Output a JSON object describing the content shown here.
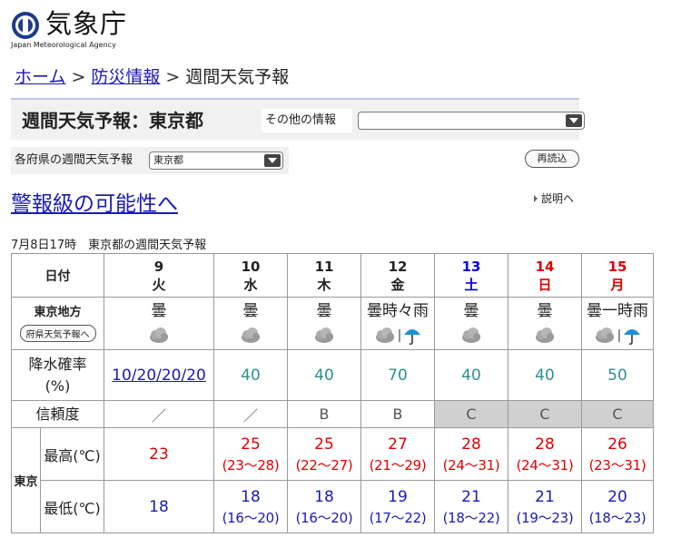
{
  "header": {
    "logo_text": "気象庁",
    "logo_sub": "Japan Meteorological Agency"
  },
  "breadcrumb": {
    "home": "ホーム",
    "sep": ">",
    "disaster": "防災情報",
    "current": "週間天気予報"
  },
  "title_box": {
    "title": "週間天気予報：東京都",
    "other_info_label": "その他の情報",
    "other_info_value": ""
  },
  "pref_bar": {
    "label": "各府県の週間天気予報",
    "selected": "東京都",
    "reload": "再読込"
  },
  "warning_link": "警報級の可能性へ",
  "explain_link": "説明へ",
  "caption": "7月8日17時　東京都の週間天気予報",
  "table": {
    "date_header": "日付",
    "days": [
      {
        "num": "9",
        "wk": "火",
        "color": "#222222"
      },
      {
        "num": "10",
        "wk": "水",
        "color": "#222222"
      },
      {
        "num": "11",
        "wk": "木",
        "color": "#222222"
      },
      {
        "num": "12",
        "wk": "金",
        "color": "#222222"
      },
      {
        "num": "13",
        "wk": "土",
        "color": "#0000e0"
      },
      {
        "num": "14",
        "wk": "日",
        "color": "#e00000"
      },
      {
        "num": "15",
        "wk": "月",
        "color": "#e00000"
      }
    ],
    "region": "東京地方",
    "pref_button": "府県天気予報へ",
    "weather": [
      "曇",
      "曇",
      "曇",
      "曇時々雨",
      "曇",
      "曇",
      "曇一時雨"
    ],
    "weather_icons": [
      [
        "cloud-icon"
      ],
      [
        "cloud-icon"
      ],
      [
        "cloud-icon"
      ],
      [
        "cloud-icon",
        "umbrella-icon"
      ],
      [
        "cloud-icon"
      ],
      [
        "cloud-icon"
      ],
      [
        "cloud-icon",
        "umbrella-icon"
      ]
    ],
    "pop_label": "降水確率",
    "pop_unit": "(%)",
    "pop": [
      "10/20/20/20",
      "40",
      "40",
      "70",
      "40",
      "40",
      "50"
    ],
    "reliability_label": "信頼度",
    "reliability": [
      "／",
      "／",
      "B",
      "B",
      "C",
      "C",
      "C"
    ],
    "city": "東京",
    "max_label": "最高(℃)",
    "min_label": "最低(℃)",
    "max": [
      "23",
      "25",
      "25",
      "27",
      "28",
      "28",
      "26"
    ],
    "max_range": [
      "",
      "(23〜28)",
      "(22〜27)",
      "(21〜29)",
      "(24〜31)",
      "(24〜31)",
      "(23〜31)"
    ],
    "min": [
      "18",
      "18",
      "18",
      "19",
      "21",
      "21",
      "20"
    ],
    "min_range": [
      "",
      "(16〜20)",
      "(16〜20)",
      "(17〜22)",
      "(18〜22)",
      "(19〜23)",
      "(18〜23)"
    ]
  },
  "colors": {
    "link": "#1a1ab5",
    "saturday": "#0000e0",
    "sunday_holiday": "#e00000",
    "max_temp": "#e00000",
    "min_temp": "#1a1ab5",
    "pop": "#2f8f8f",
    "reliability_c_bg": "#d0d0d0"
  }
}
